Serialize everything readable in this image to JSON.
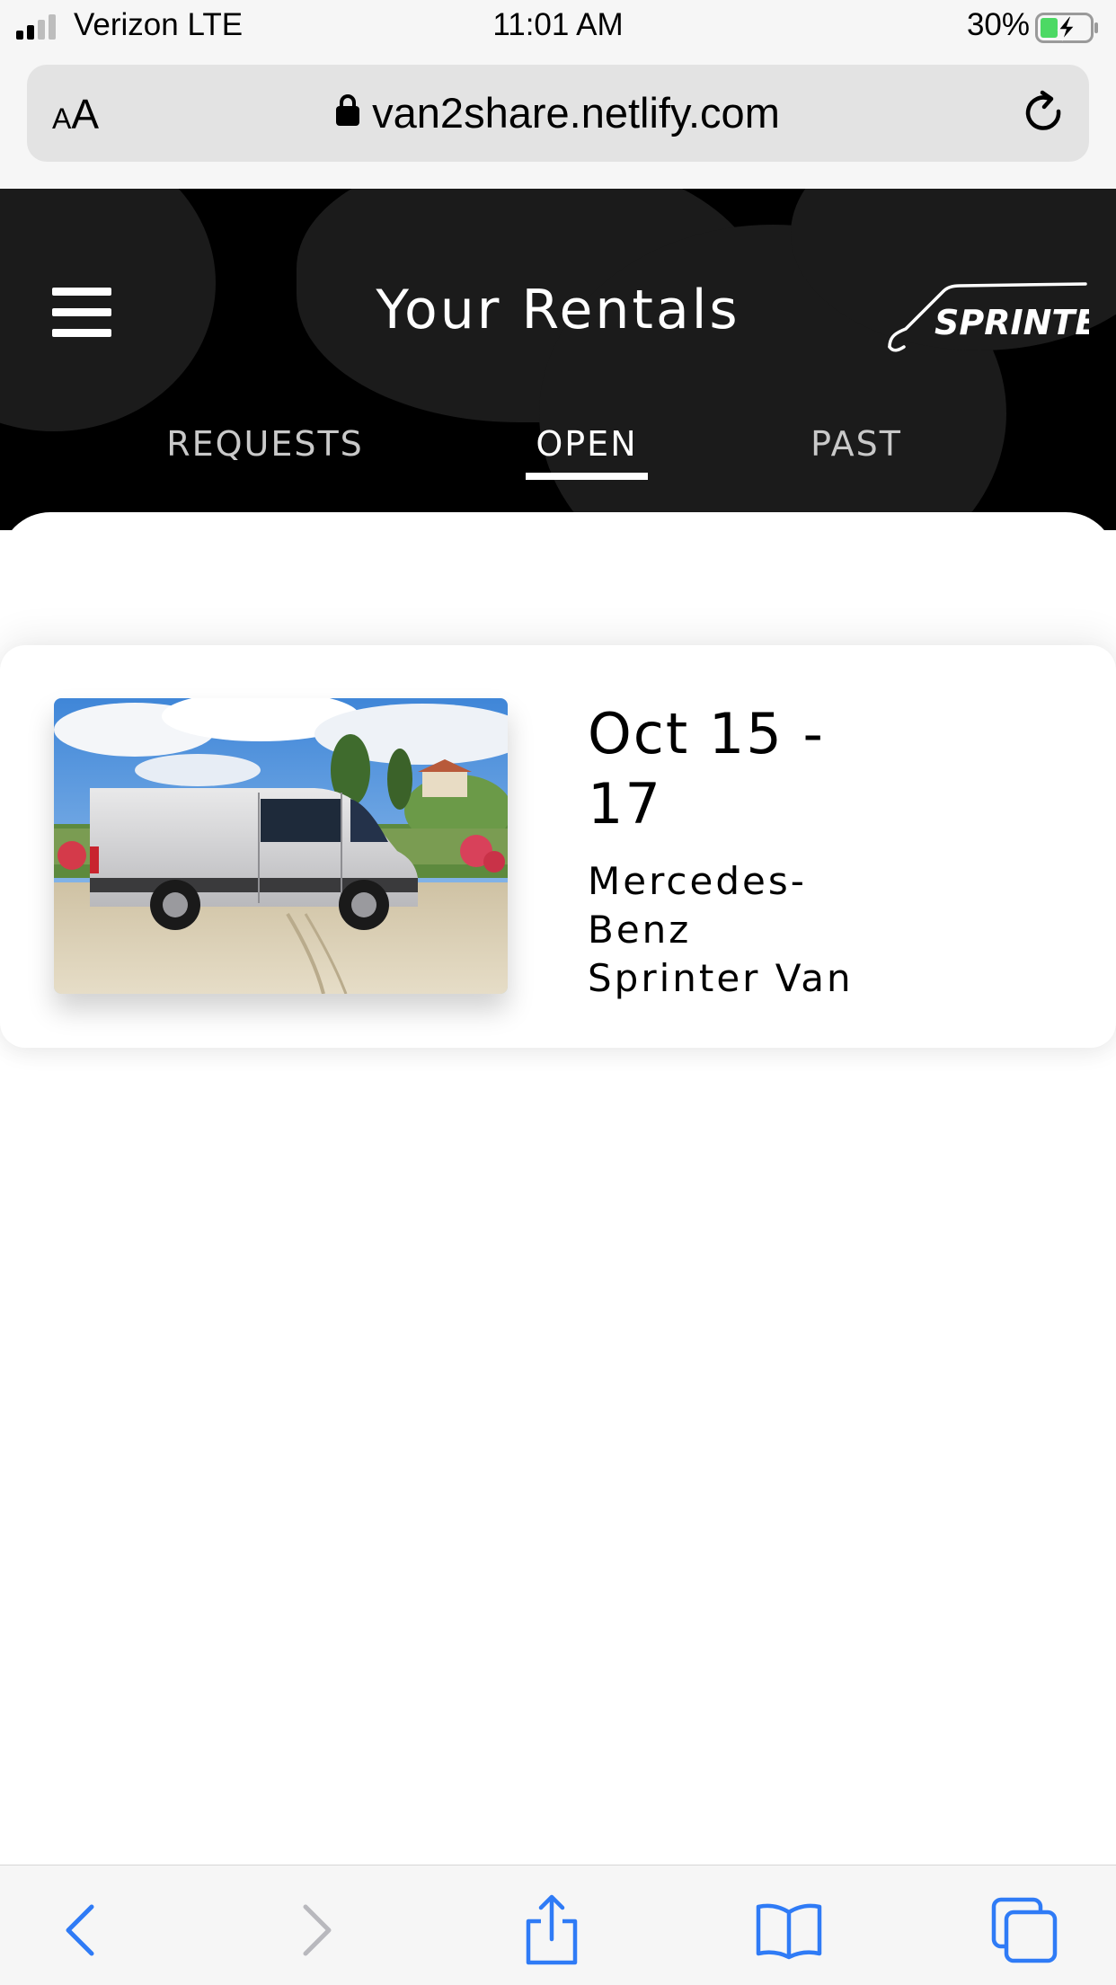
{
  "status_bar": {
    "carrier": "Verizon LTE",
    "time": "11:01 AM",
    "battery": "30%"
  },
  "browser": {
    "aa_label_small": "A",
    "aa_label_large": "A",
    "url": "van2share.netlify.com",
    "icons": [
      "lock-icon",
      "reload-icon"
    ]
  },
  "header": {
    "title": "Your Rentals",
    "logo_text": "SPRINTER",
    "tabs": [
      {
        "label": "REQUESTS",
        "active": false
      },
      {
        "label": "OPEN",
        "active": true
      },
      {
        "label": "PAST",
        "active": false
      }
    ]
  },
  "rentals": [
    {
      "dates_line1": "Oct 15 -",
      "dates_line2": "17",
      "vehicle_line1": "Mercedes-",
      "vehicle_line2": "Benz",
      "vehicle_line3": "Sprinter Van"
    }
  ],
  "toolbar": {
    "icons": [
      "back-icon",
      "forward-icon",
      "share-icon",
      "bookmarks-icon",
      "tabs-icon"
    ]
  },
  "colors": {
    "header_bg": "#000000",
    "accent": "#2f7bf6",
    "inactive_tab": "#c9c9c9"
  }
}
